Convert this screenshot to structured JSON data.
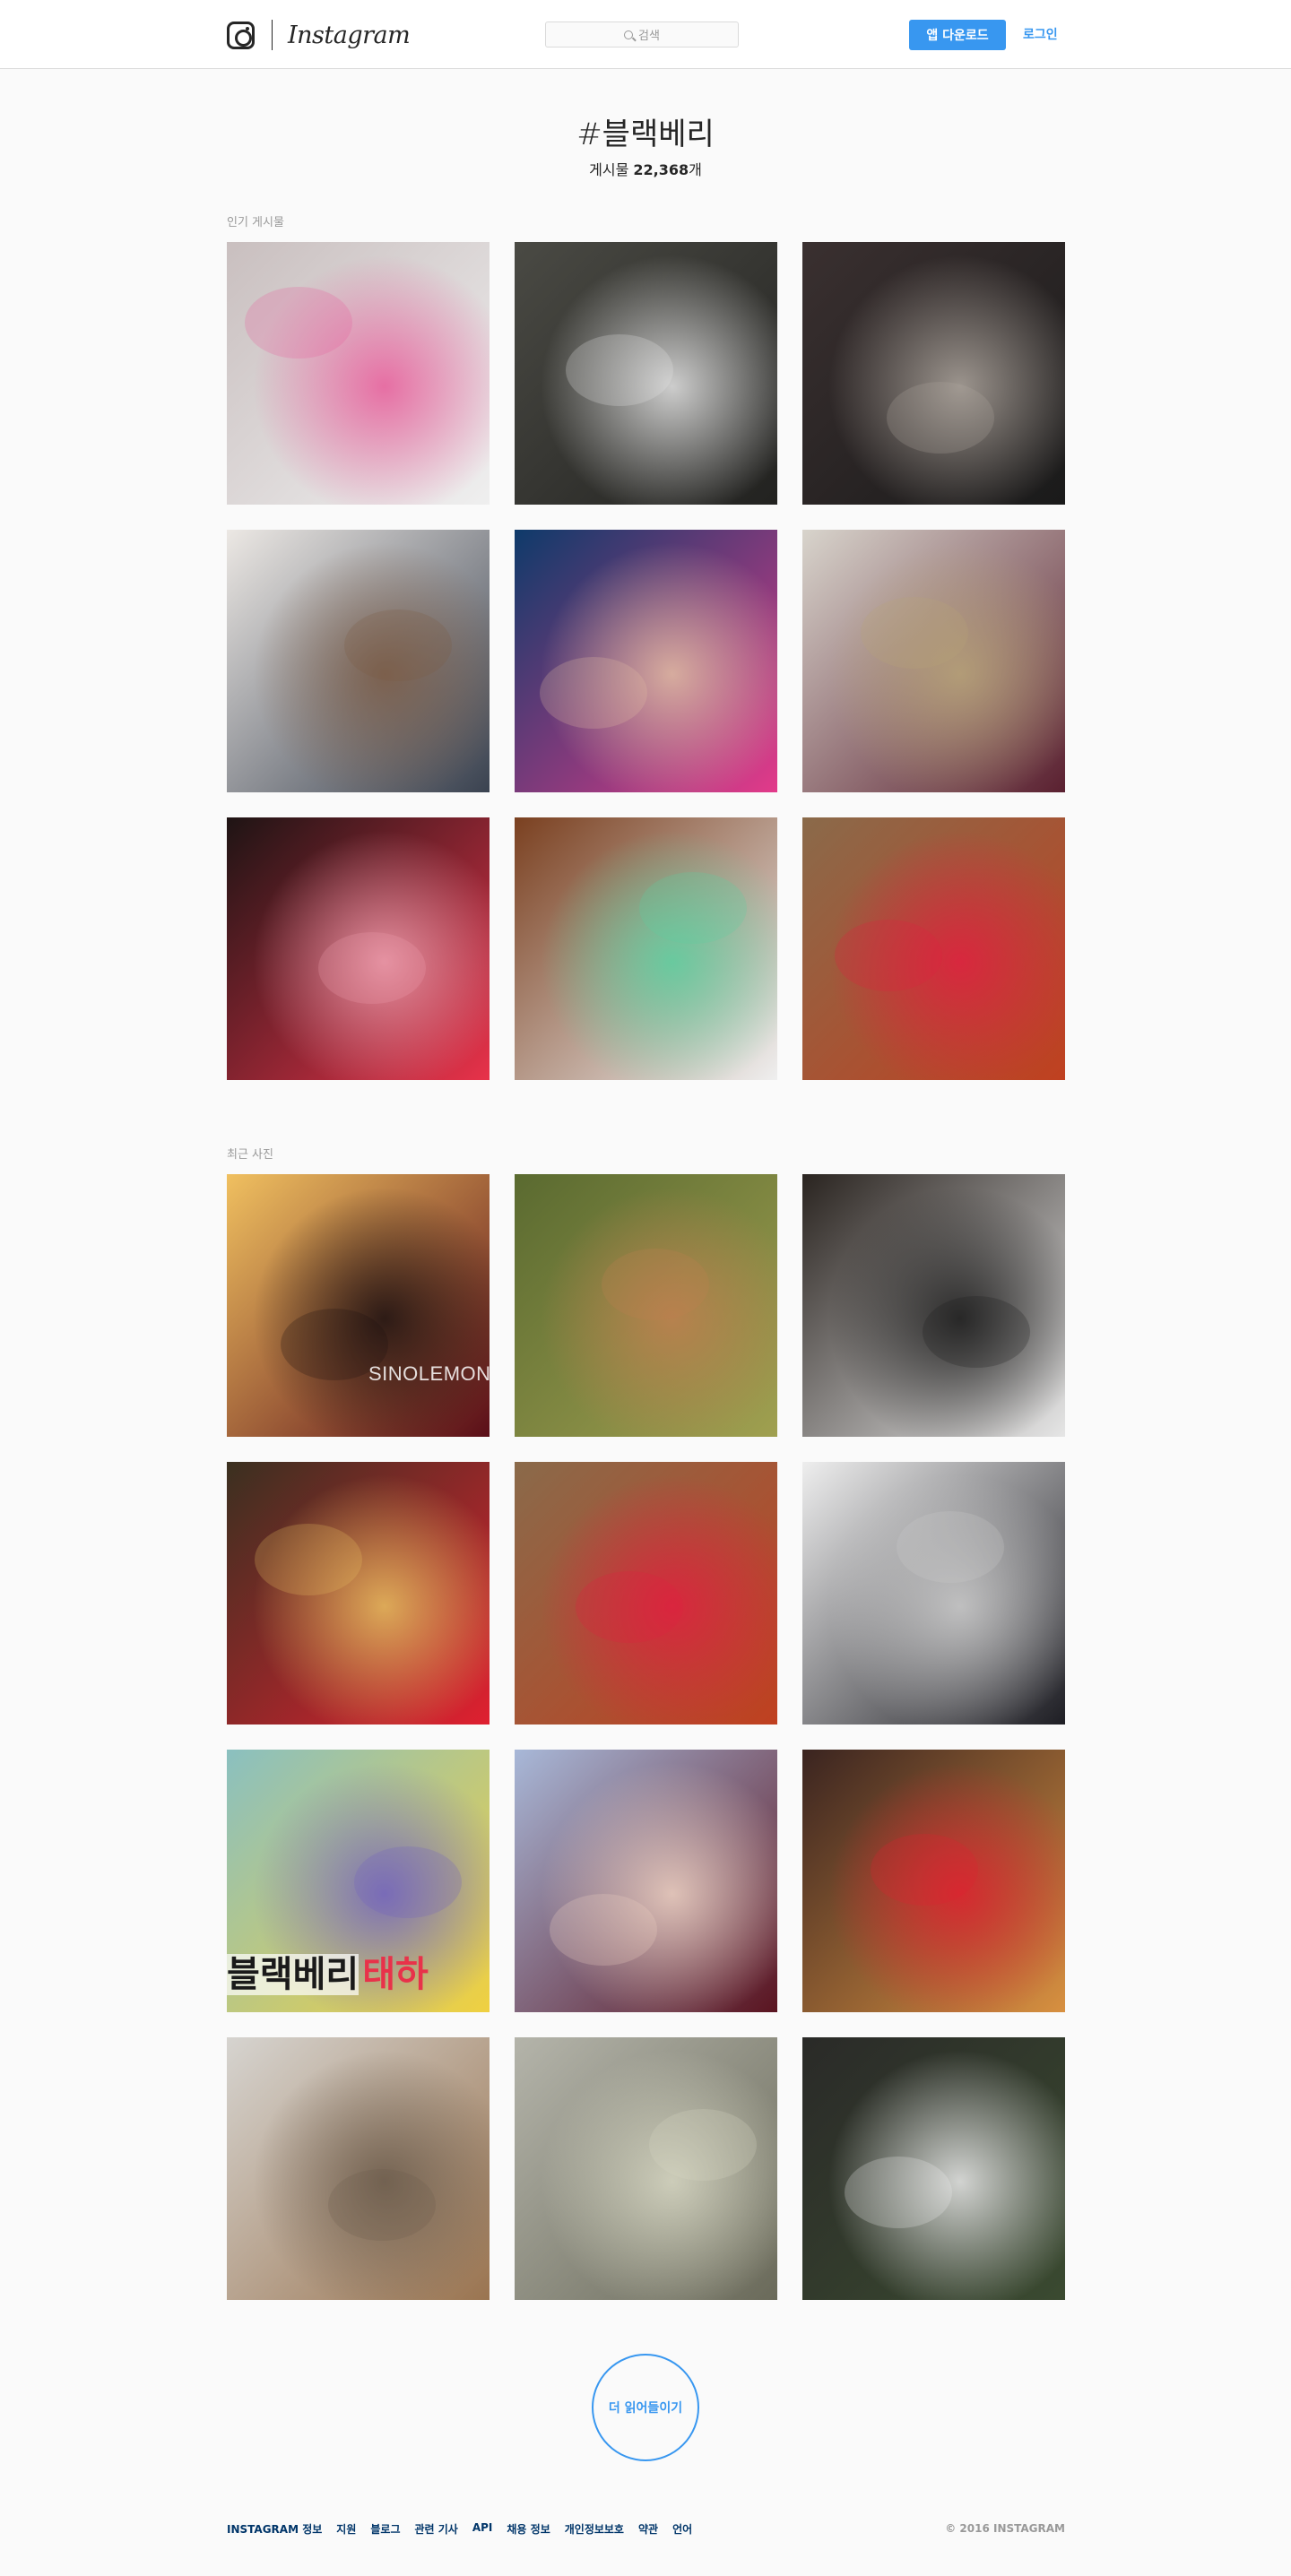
{
  "header": {
    "logo_text": "Instagram",
    "search_placeholder": "검색",
    "app_download_label": "앱 다운로드",
    "login_label": "로그인"
  },
  "tag": {
    "title": "#블랙베리",
    "count_prefix": "게시물 ",
    "count_value": "22,368",
    "count_suffix": "개"
  },
  "sections": {
    "popular_label": "인기 게시물",
    "recent_label": "최근 사진"
  },
  "popular_posts": [
    {
      "subject": "eight blackberry phones on carpet",
      "colors": [
        "#c9bfbf",
        "#efefef",
        "#e85c9a"
      ]
    },
    {
      "subject": "black blackberry classic on dark surface",
      "colors": [
        "#4a4a44",
        "#222220",
        "#e8e8e8"
      ]
    },
    {
      "subject": "hand holding black blackberry",
      "colors": [
        "#3a3030",
        "#1a1a1a",
        "#b0a8a0"
      ]
    },
    {
      "subject": "woman taking mirror selfie",
      "colors": [
        "#ece8e4",
        "#3a4250",
        "#7a5a44"
      ]
    },
    {
      "subject": "hand holding pink blackberry q5",
      "colors": [
        "#0e3a6a",
        "#e33a8a",
        "#e4c0a4"
      ]
    },
    {
      "subject": "bowl of berries and seeds",
      "colors": [
        "#d8d4cc",
        "#5a2030",
        "#b8a478"
      ]
    },
    {
      "subject": "red blackberry q5 in hand",
      "colors": [
        "#1e1414",
        "#e8324a",
        "#f0a0b0"
      ]
    },
    {
      "subject": "row of colorful blackberry phones",
      "colors": [
        "#7a4020",
        "#efefef",
        "#5ad0a0"
      ]
    },
    {
      "subject": "fries and red blackberry on table",
      "colors": [
        "#8a6a4a",
        "#c04020",
        "#e02040"
      ]
    }
  ],
  "recent_posts": [
    {
      "subject": "blackberry jam jar",
      "colors": [
        "#f0c060",
        "#5a0e18",
        "#1a1010"
      ],
      "overlay_text": "SINOLEMON"
    },
    {
      "subject": "animal lying in grass",
      "colors": [
        "#5a6a30",
        "#a0a050",
        "#c08050"
      ]
    },
    {
      "subject": "white blackberry classic back",
      "colors": [
        "#2a2420",
        "#e6e6e6",
        "#1a1a1a"
      ]
    },
    {
      "subject": "berries and yogurt spread",
      "colors": [
        "#3a3020",
        "#e02030",
        "#e8c060"
      ]
    },
    {
      "subject": "fries and red blackberry on table",
      "colors": [
        "#8a6a4a",
        "#c04020",
        "#e02040"
      ]
    },
    {
      "subject": "black blackberry on white sheet",
      "colors": [
        "#eeeeee",
        "#1e1e24",
        "#cccccc"
      ]
    },
    {
      "subject": "girl in yellow sweater with balloons",
      "colors": [
        "#8ac0c0",
        "#f0d040",
        "#7060c0"
      ],
      "overlay_text_a": "블랙베리",
      "overlay_text_b": "태하"
    },
    {
      "subject": "woman pouting close up",
      "colors": [
        "#a8b8d8",
        "#5a1420",
        "#f0d4c4"
      ]
    },
    {
      "subject": "waffle with berries and cream",
      "colors": [
        "#3a2420",
        "#d89040",
        "#e02030"
      ]
    },
    {
      "subject": "small bird on branch",
      "colors": [
        "#d6d4d0",
        "#9a7450",
        "#6a5a4a"
      ]
    },
    {
      "subject": "bird among branches",
      "colors": [
        "#b4b4aa",
        "#6a6a5a",
        "#d8d8c4"
      ]
    },
    {
      "subject": "dark room with plant and furry chair",
      "colors": [
        "#2a2a28",
        "#3a4a30",
        "#eeeeee"
      ]
    }
  ],
  "load_more_label": "더 읽어들이기",
  "footer": {
    "links": [
      "Instagram 정보",
      "지원",
      "블로그",
      "관련 기사",
      "API",
      "채용 정보",
      "개인정보보호",
      "약관",
      "언어"
    ],
    "copyright": "© 2016 Instagram"
  }
}
